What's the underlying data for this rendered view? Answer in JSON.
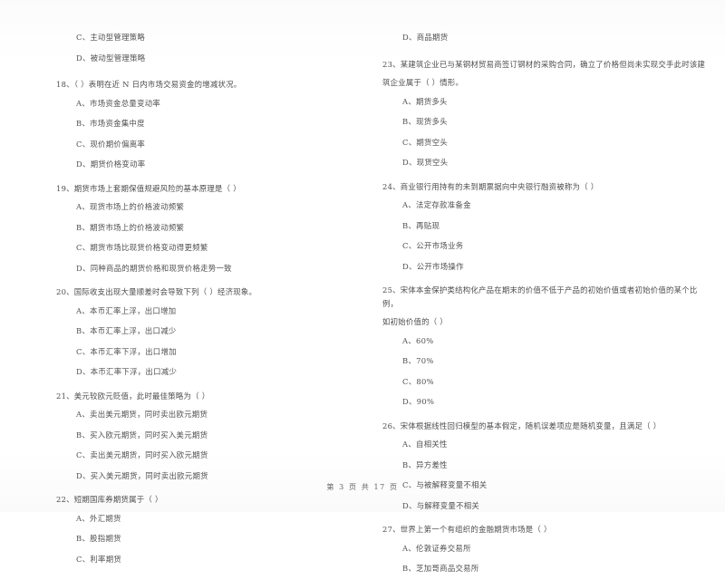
{
  "document": {
    "type": "exam-paper-scan",
    "footer": "第 3 页 共 17 页"
  },
  "left_column": {
    "orphan_options": [
      "C、主动型管理策略",
      "D、被动型管理策略"
    ],
    "questions": [
      {
        "number": "18",
        "stem": "18、（      ）表明在近 N 日内市场交易资金的增减状况。",
        "options": [
          "A、市场资金总量变动率",
          "B、市场资金集中度",
          "C、现价期价偏离率",
          "D、期货价格变动率"
        ]
      },
      {
        "number": "19",
        "stem": "19、期货市场上套期保值规避风险的基本原理是（      ）",
        "options": [
          "A、现货市场上的价格波动频繁",
          "B、期货市场上的价格波动频繁",
          "C、期货市场比现货价格变动得更频繁",
          "D、同种商品的期货价格和现货价格走势一致"
        ]
      },
      {
        "number": "20",
        "stem": "20、国际收支出现大量顺差时会导致下列（      ）经济现象。",
        "options": [
          "A、本币汇率上浮，出口增加",
          "B、本币汇率上浮，出口减少",
          "C、本币汇率下浮，出口增加",
          "D、本币汇率下浮，出口减少"
        ]
      },
      {
        "number": "21",
        "stem": "21、美元较欧元贬值，此时最佳策略为（      ）",
        "options": [
          "A、卖出美元期货，同时卖出欧元期货",
          "B、买入欧元期货，同时买入美元期货",
          "C、卖出美元期货，同时买入欧元期货",
          "D、买入美元期货，同时卖出欧元期货"
        ]
      },
      {
        "number": "22",
        "stem": "22、短期国库券期货属于（      ）",
        "options": [
          "A、外汇期货",
          "B、股指期货",
          "C、利率期货"
        ]
      }
    ]
  },
  "right_column": {
    "orphan_options": [
      "D、商品期货"
    ],
    "questions": [
      {
        "number": "23",
        "stem_line1": "23、某建筑企业已与某钢材贸易商签订钢材的采购合同，确立了价格但尚未实现交手此时该建",
        "stem_line2": "筑企业属于（      ）情形。",
        "options": [
          "A、期货多头",
          "B、现货多头",
          "C、期货空头",
          "D、现货空头"
        ]
      },
      {
        "number": "24",
        "stem_line1": "24、商业银行用持有的未到期票据向中央银行融资被称为（      ）",
        "stem_line2": "",
        "options": [
          "A、法定存款准备金",
          "B、再贴现",
          "C、公开市场业务",
          "D、公开市场操作"
        ]
      },
      {
        "number": "25",
        "stem_line1": "25、宋体本金保护类结构化产品在期末的价值不低于产品的初始价值或者初始价值的某个比例，",
        "stem_line2": "如初始价值的（      ）",
        "options": [
          "A、60%",
          "B、70%",
          "C、80%",
          "D、90%"
        ]
      },
      {
        "number": "26",
        "stem_line1": "26、宋体根据线性回归模型的基本假定，随机误差项应是随机变量，且满足（      ）",
        "stem_line2": "",
        "options": [
          "A、自相关性",
          "B、异方差性",
          "C、与被解释变量不相关",
          "D、与解释变量不相关"
        ]
      },
      {
        "number": "27",
        "stem_line1": "27、世界上第一个有组织的金融期货市场是（      ）",
        "stem_line2": "",
        "options": [
          "A、伦敦证券交易所",
          "B、芝加哥商品交易所"
        ]
      }
    ]
  }
}
